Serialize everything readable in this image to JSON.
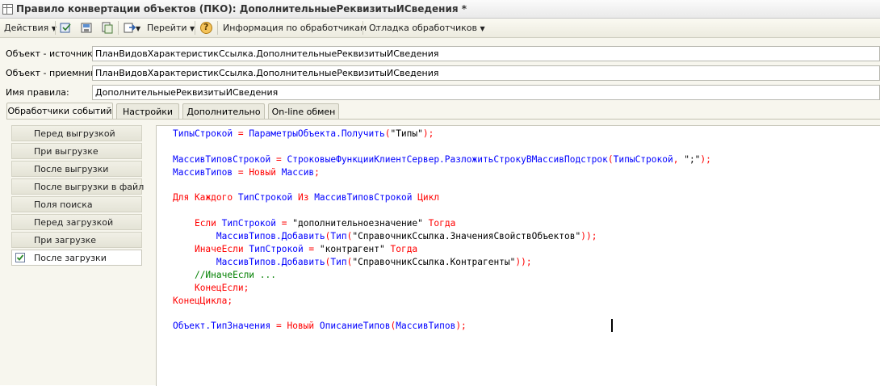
{
  "window": {
    "title": "Правило конвертации объектов (ПКО): ДополнительныеРеквизитыИСведения *"
  },
  "toolbar": {
    "actions_label": "Действия",
    "goto_label": "Перейти",
    "help_label": "?",
    "handlers_info_label": "Информация по обработчикам ...",
    "debug_label": "Отладка обработчиков"
  },
  "form": {
    "source_label": "Объект - источник:",
    "source_value": "ПланВидовХарактеристикСсылка.ДополнительныеРеквизитыИСведения",
    "target_label": "Объект - приемник:",
    "target_value": "ПланВидовХарактеристикСсылка.ДополнительныеРеквизитыИСведения",
    "rule_name_label": "Имя правила:",
    "rule_name_value": "ДополнительныеРеквизитыИСведения"
  },
  "tabs": [
    {
      "label": "Обработчики событий"
    },
    {
      "label": "Настройки"
    },
    {
      "label": "Дополнительно"
    },
    {
      "label": "On-line обмен"
    }
  ],
  "event_handlers": [
    {
      "label": "Перед выгрузкой"
    },
    {
      "label": "При выгрузке"
    },
    {
      "label": "После выгрузки"
    },
    {
      "label": "После выгрузки в файл"
    },
    {
      "label": "Поля поиска"
    },
    {
      "label": "Перед загрузкой"
    },
    {
      "label": "При загрузке"
    },
    {
      "label": "После загрузки"
    }
  ],
  "code": {
    "lines": [
      [
        [
          "id",
          "ТипыСтрокой"
        ],
        [
          "op",
          " = "
        ],
        [
          "id",
          "ПараметрыОбъекта.Получить"
        ],
        [
          "op",
          "("
        ],
        [
          "str",
          "\"Типы\""
        ],
        [
          "op",
          ");"
        ]
      ],
      [],
      [
        [
          "id",
          "МассивТиповСтрокой"
        ],
        [
          "op",
          " = "
        ],
        [
          "id",
          "СтроковыеФункцииКлиентСервер.РазложитьСтрокуВМассивПодстрок"
        ],
        [
          "op",
          "("
        ],
        [
          "id",
          "ТипыСтрокой"
        ],
        [
          "op",
          ", "
        ],
        [
          "str",
          "\";\""
        ],
        [
          "op",
          ");"
        ]
      ],
      [
        [
          "id",
          "МассивТипов"
        ],
        [
          "op",
          " = "
        ],
        [
          "kw",
          "Новый"
        ],
        [
          "op",
          " "
        ],
        [
          "id",
          "Массив"
        ],
        [
          "op",
          ";"
        ]
      ],
      [],
      [
        [
          "kw",
          "Для Каждого"
        ],
        [
          "op",
          " "
        ],
        [
          "id",
          "ТипСтрокой"
        ],
        [
          "op",
          " "
        ],
        [
          "kw",
          "Из"
        ],
        [
          "op",
          " "
        ],
        [
          "id",
          "МассивТиповСтрокой"
        ],
        [
          "op",
          " "
        ],
        [
          "kw",
          "Цикл"
        ]
      ],
      [],
      [
        [
          "op",
          "    "
        ],
        [
          "kw",
          "Если"
        ],
        [
          "op",
          " "
        ],
        [
          "id",
          "ТипСтрокой"
        ],
        [
          "op",
          " = "
        ],
        [
          "str",
          "\"дополнительноезначение\""
        ],
        [
          "op",
          " "
        ],
        [
          "kw",
          "Тогда"
        ]
      ],
      [
        [
          "op",
          "        "
        ],
        [
          "id",
          "МассивТипов.Добавить"
        ],
        [
          "op",
          "("
        ],
        [
          "id",
          "Тип"
        ],
        [
          "op",
          "("
        ],
        [
          "str",
          "\"СправочникСсылка.ЗначенияСвойствОбъектов\""
        ],
        [
          "op",
          "));"
        ]
      ],
      [
        [
          "op",
          "    "
        ],
        [
          "kw",
          "ИначеЕсли"
        ],
        [
          "op",
          " "
        ],
        [
          "id",
          "ТипСтрокой"
        ],
        [
          "op",
          " = "
        ],
        [
          "str",
          "\"контрагент\""
        ],
        [
          "op",
          " "
        ],
        [
          "kw",
          "Тогда"
        ]
      ],
      [
        [
          "op",
          "        "
        ],
        [
          "id",
          "МассивТипов.Добавить"
        ],
        [
          "op",
          "("
        ],
        [
          "id",
          "Тип"
        ],
        [
          "op",
          "("
        ],
        [
          "str",
          "\"СправочникСсылка.Контрагенты\""
        ],
        [
          "op",
          "));"
        ]
      ],
      [
        [
          "op",
          "    "
        ],
        [
          "cm",
          "//ИначеЕсли ..."
        ]
      ],
      [
        [
          "op",
          "    "
        ],
        [
          "kw",
          "КонецЕсли"
        ],
        [
          "op",
          ";"
        ]
      ],
      [
        [
          "kw",
          "КонецЦикла"
        ],
        [
          "op",
          ";"
        ]
      ],
      [],
      [
        [
          "id",
          "Объект.ТипЗначения"
        ],
        [
          "op",
          " = "
        ],
        [
          "kw",
          "Новый"
        ],
        [
          "op",
          " "
        ],
        [
          "id",
          "ОписаниеТипов"
        ],
        [
          "op",
          "("
        ],
        [
          "id",
          "МассивТипов"
        ],
        [
          "op",
          ");"
        ]
      ]
    ]
  },
  "colors": {
    "keyword": "#ff0000",
    "identifier": "#0000ff",
    "comment": "#008000",
    "string": "#000000"
  }
}
